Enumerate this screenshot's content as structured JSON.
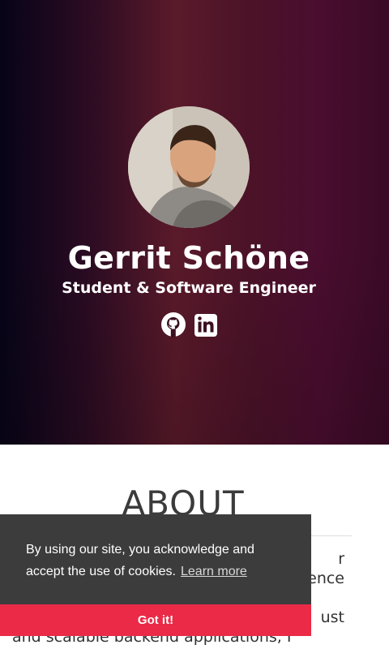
{
  "hero": {
    "name": "Gerrit Schöne",
    "subtitle": "Student & Software Engineer",
    "social": [
      {
        "icon": "github-icon",
        "label": "GitHub"
      },
      {
        "icon": "linkedin-icon",
        "label": "LinkedIn"
      }
    ]
  },
  "about": {
    "title": "ABOUT",
    "text_lines": [
      "r",
      "ence",
      "ust",
      "and scalable backend applications, I"
    ]
  },
  "cookie": {
    "message": "By using our site, you acknowledge and accept the use of cookies.",
    "learn_more": "Learn more",
    "button": "Got it!"
  },
  "colors": {
    "hero_left": "#070418",
    "hero_mid": "#5a1a2a",
    "hero_right": "#3a0a26",
    "cookie_bg": "#3c3c3c",
    "cookie_button": "#ea2a47"
  }
}
